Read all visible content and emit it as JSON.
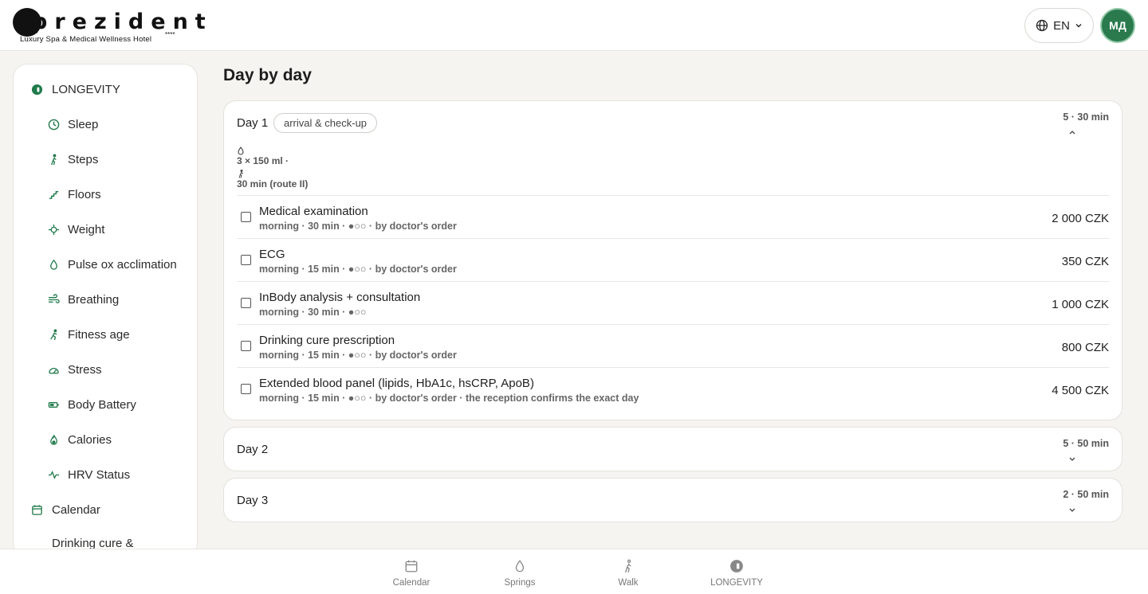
{
  "header": {
    "logo_text": "prezident",
    "logo_subtitle": "Luxury Spa & Medical Wellness Hotel",
    "logo_stars": "****",
    "language": "EN",
    "avatar_initials": "МД",
    "colors": {
      "avatar_bg": "#2a7a4e",
      "accent": "#1f7a4a"
    }
  },
  "sidebar": {
    "section": {
      "label": "LONGEVITY",
      "icon": "longevity-icon"
    },
    "items": [
      {
        "label": "Sleep",
        "icon": "clock-icon"
      },
      {
        "label": "Steps",
        "icon": "walker-icon"
      },
      {
        "label": "Floors",
        "icon": "stairs-icon"
      },
      {
        "label": "Weight",
        "icon": "crosshair-icon"
      },
      {
        "label": "Pulse ox acclimation",
        "icon": "drop-icon"
      },
      {
        "label": "Breathing",
        "icon": "wind-icon"
      },
      {
        "label": "Fitness age",
        "icon": "runner-icon"
      },
      {
        "label": "Stress",
        "icon": "gauge-icon"
      },
      {
        "label": "Body Battery",
        "icon": "battery-icon"
      },
      {
        "label": "Calories",
        "icon": "flame-icon"
      },
      {
        "label": "HRV Status",
        "icon": "pulse-icon"
      }
    ],
    "calendar": {
      "label": "Calendar",
      "icon": "calendar-icon"
    },
    "drinking": {
      "label": "Drinking cure &",
      "icon": "calendar-icon"
    }
  },
  "main": {
    "title": "Day by day",
    "days": [
      {
        "label": "Day 1",
        "tag": "arrival & check-up",
        "summary": "5 · 30 min",
        "expanded": true,
        "water": "3 × 150 ml ·",
        "walk": "30 min (route II)",
        "items": [
          {
            "title": "Medical examination",
            "sub": "morning · 30 min · ●○○ · by doctor's order",
            "price": "2 000 CZK"
          },
          {
            "title": "ECG",
            "sub": "morning · 15 min · ●○○ · by doctor's order",
            "price": "350 CZK"
          },
          {
            "title": "InBody analysis + consultation",
            "sub": "morning · 30 min · ●○○",
            "price": "1 000 CZK"
          },
          {
            "title": "Drinking cure prescription",
            "sub": "morning · 15 min · ●○○ · by doctor's order",
            "price": "800 CZK"
          },
          {
            "title": "Extended blood panel (lipids, HbA1c, hsCRP, ApoB)",
            "sub": "morning · 15 min · ●○○ · by doctor's order · the reception confirms the exact day",
            "price": "4 500 CZK"
          }
        ]
      },
      {
        "label": "Day 2",
        "summary": "5 · 50 min",
        "expanded": false
      },
      {
        "label": "Day 3",
        "summary": "2 · 50 min",
        "expanded": false
      }
    ]
  },
  "bottom_nav": [
    {
      "label": "Calendar",
      "icon": "calendar-icon"
    },
    {
      "label": "Springs",
      "icon": "drop-icon"
    },
    {
      "label": "Walk",
      "icon": "walker-icon"
    },
    {
      "label": "LONGEVITY",
      "icon": "longevity-icon"
    }
  ]
}
